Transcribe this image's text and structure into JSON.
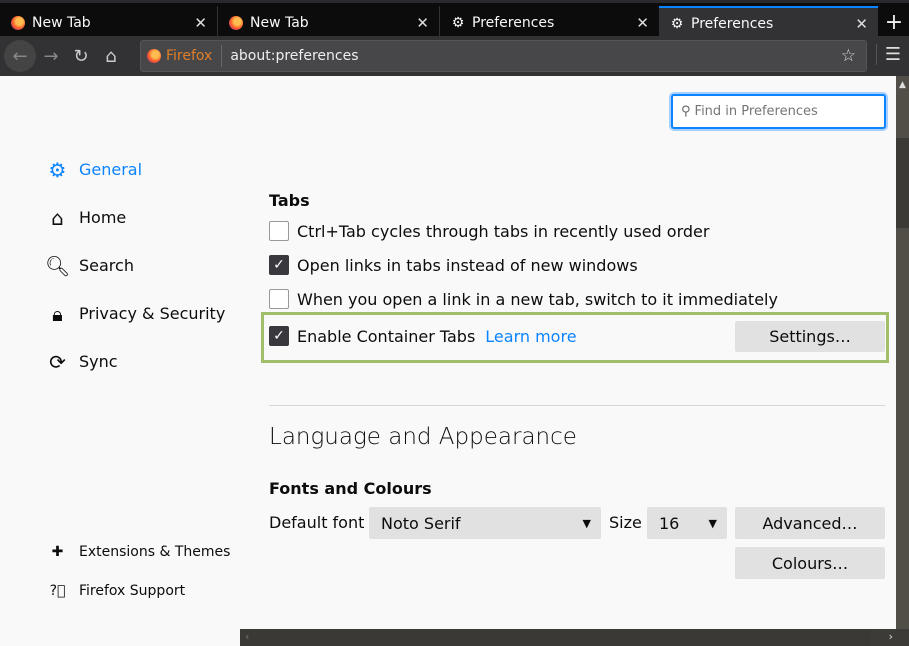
{
  "tabs": [
    {
      "label": "New Tab",
      "icon": "firefox-icon",
      "underline": "none"
    },
    {
      "label": "New Tab",
      "icon": "firefox-icon",
      "underline": "#2c8be7"
    },
    {
      "label": "Preferences",
      "icon": "gear-icon",
      "underline": "#e6921a"
    },
    {
      "label": "Preferences",
      "icon": "gear-icon",
      "active": true
    }
  ],
  "toolbar": {
    "brand": "Firefox",
    "url": "about:preferences"
  },
  "search": {
    "placeholder": "Find in Preferences"
  },
  "sidebar": {
    "items": [
      {
        "label": "General",
        "icon": "gear-icon",
        "selected": true
      },
      {
        "label": "Home",
        "icon": "home-icon"
      },
      {
        "label": "Search",
        "icon": "search-icon"
      },
      {
        "label": "Privacy & Security",
        "icon": "lock-icon"
      },
      {
        "label": "Sync",
        "icon": "sync-icon"
      }
    ],
    "footer": [
      {
        "label": "Extensions & Themes",
        "icon": "puzzle-icon"
      },
      {
        "label": "Firefox Support",
        "icon": "help-icon"
      }
    ]
  },
  "tabs_section": {
    "title": "Tabs",
    "options": [
      {
        "label": "Ctrl+Tab cycles through tabs in recently used order",
        "checked": false
      },
      {
        "label": "Open links in tabs instead of new windows",
        "checked": true
      },
      {
        "label": "When you open a link in a new tab, switch to it immediately",
        "checked": false
      },
      {
        "label": "Enable Container Tabs",
        "checked": true
      }
    ],
    "learn_more": "Learn more",
    "settings_button": "Settings…"
  },
  "language": {
    "title": "Language and Appearance",
    "fonts_title": "Fonts and Colours",
    "default_font_label": "Default font",
    "default_font_value": "Noto Serif",
    "size_label": "Size",
    "size_value": "16",
    "advanced_button": "Advanced…",
    "colours_button": "Colours…"
  },
  "colors": {
    "accent": "#0a84ff",
    "highlight": "#a1be6a"
  }
}
